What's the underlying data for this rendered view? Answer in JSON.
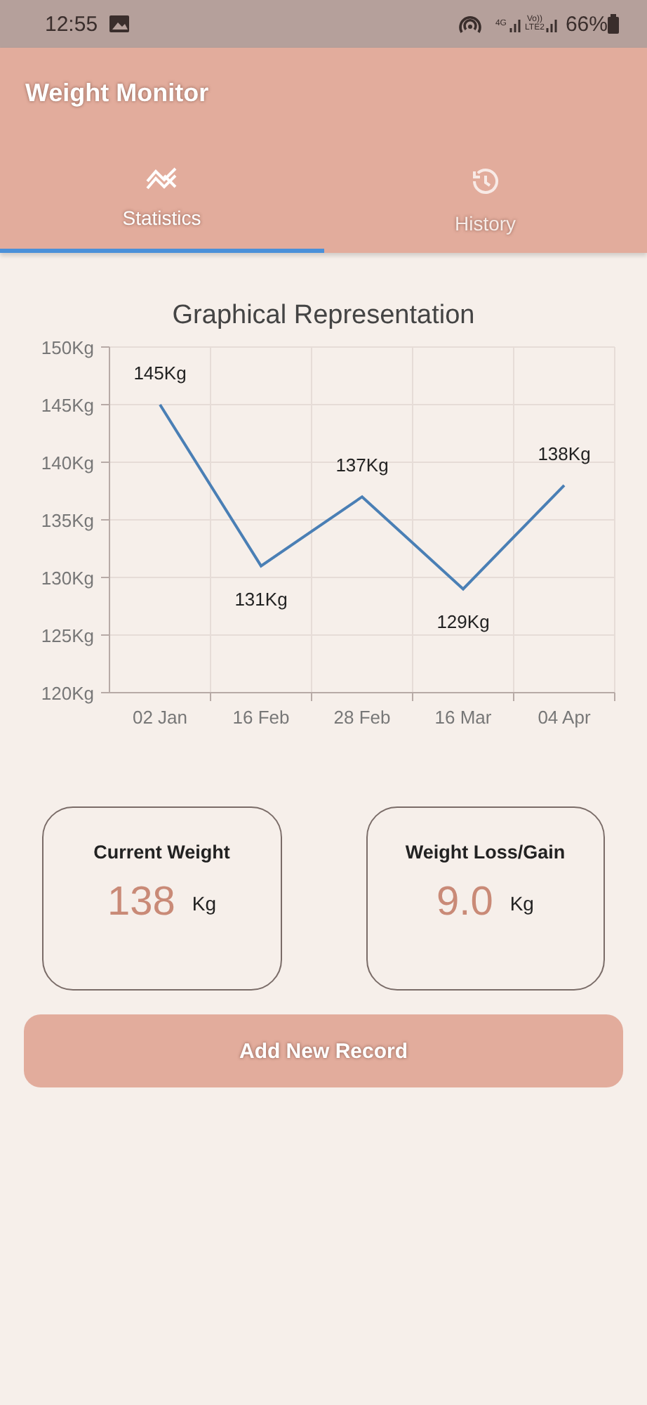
{
  "status_bar": {
    "time": "12:55",
    "network": "4G",
    "volte": "Vo)) LTE2",
    "battery": "66%"
  },
  "app_bar": {
    "title": "Weight Monitor"
  },
  "tabs": [
    {
      "label": "Statistics",
      "kind": "chart",
      "selected": true
    },
    {
      "label": "History",
      "kind": "history",
      "selected": false
    }
  ],
  "chart": {
    "title": "Graphical Representation",
    "chart_data": {
      "type": "line",
      "categories": [
        "02 Jan",
        "16 Feb",
        "28 Feb",
        "16 Mar",
        "04 Apr"
      ],
      "grid": true,
      "series": [
        {
          "color": "#4a7fb5",
          "values": [
            145,
            131,
            137,
            129,
            138
          ]
        }
      ],
      "ylim": [
        120,
        150
      ],
      "yticks": [
        {
          "value": 120,
          "label": "120Kg"
        },
        {
          "value": 125,
          "label": "125Kg"
        },
        {
          "value": 130,
          "label": "130Kg"
        },
        {
          "value": 135,
          "label": "135Kg"
        },
        {
          "value": 140,
          "label": "140Kg"
        },
        {
          "value": 145,
          "label": "145Kg"
        },
        {
          "value": 150,
          "label": "150Kg"
        }
      ],
      "value_labels": [
        "145Kg",
        "131Kg",
        "137Kg",
        "129Kg",
        "138Kg"
      ]
    }
  },
  "cards": [
    {
      "title": "Current Weight",
      "value": "138",
      "unit": "Kg"
    },
    {
      "title": "Weight Loss/Gain",
      "value": "9.0",
      "unit": "Kg"
    }
  ],
  "button": {
    "label": "Add New Record"
  }
}
